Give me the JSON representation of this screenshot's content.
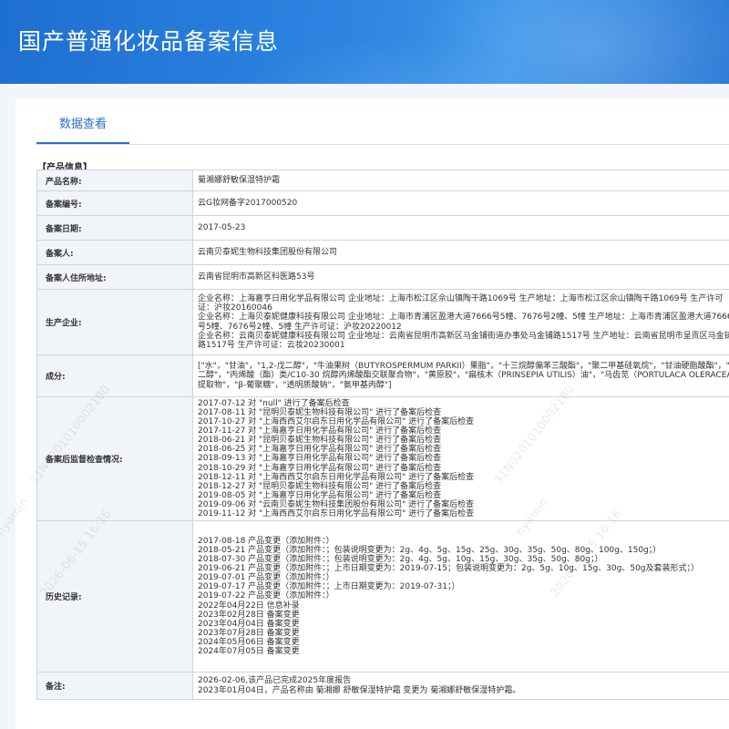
{
  "header": {
    "title": "国产普通化妆品备案信息"
  },
  "tabs": [
    {
      "label": "数据查看"
    }
  ],
  "section": {
    "title": "【产品信息】"
  },
  "rows": {
    "product_name": {
      "label": "产品名称:",
      "value": "菊湘娜舒敏保湿特护霜"
    },
    "record_no": {
      "label": "备案编号:",
      "value": "云G妆网备字2017000520"
    },
    "record_date": {
      "label": "备案日期:",
      "value": "2017-05-23"
    },
    "registrant": {
      "label": "备案人:",
      "value": "云南贝泰妮生物科技集团股份有限公司"
    },
    "registrant_address": {
      "label": "备案人住所地址:",
      "value": "云南省昆明市高新区科医路53号"
    },
    "manufacturer": {
      "label": "生产企业:",
      "lines": [
        "企业名称：上海嘉亨日用化学品有限公司 企业地址：上海市松江区佘山镇陶干路1069号 生产地址：上海市松江区佘山镇陶干路1069号 生产许可证：沪妆20160046",
        "企业名称：上海贝泰妮健康科技有限公司 企业地址：上海市青浦区盈港大道7666号5幢、7676号2幢、5幢 生产地址：上海市青浦区盈港大道7666号5幢、7676号2幢、5幢 生产许可证：沪妆20220012",
        "企业名称：云南贝泰妮健康科技有限公司 企业地址：云南省昆明市高新区马金铺街道办事处马金铺路1517号 生产地址：云南省昆明市呈贡区马金铺路1517号 生产许可证：云妆20230001"
      ]
    },
    "ingredients": {
      "label": "成分:",
      "value": "[\"水\"，\"甘油\"，\"1,2-戊二醇\"，\"牛油果树（BUTYROSPERMUM PARKII）果脂\"，\"十三烷醇偏苯三酸酯\"，\"聚二甲基硅氧烷\"，\"甘油硬脂酸酯\"，\"丁二醇\"，\"丙烯酸（酯）类/C10-30 烷醇丙烯酸酯交联聚合物\"，\"黄原胶\"，\"扁核木（PRINSEPIA UTILIS）油\"，\"马齿苋（PORTULACA OLERACEA）提取物\"，\"β-葡聚糖\"，\"透明质酸钠\"，\"氨甲基丙醇\"]"
    },
    "inspection": {
      "label": "备案后监督检查情况:",
      "lines": [
        "2017-07-12 对 \"null\" 进行了备案后检查",
        "2017-08-11 对 \"昆明贝泰妮生物科技有限公司\" 进行了备案后检查",
        "2017-10-27 对 \"上海西西艾尔启东日用化学品有限公司\" 进行了备案后检查",
        "2017-11-27 对 \"上海嘉亨日用化学品有限公司\" 进行了备案后检查",
        "2018-06-21 对 \"昆明贝泰妮生物科技有限公司\" 进行了备案后检查",
        "2018-06-25 对 \"上海嘉亨日用化学品有限公司\" 进行了备案后检查",
        "2018-09-13 对 \"上海嘉亨日用化学品有限公司\" 进行了备案后检查",
        "2018-10-29 对 \"上海嘉亨日用化学品有限公司\" 进行了备案后检查",
        "2018-12-11 对 \"上海西西艾尔启东日用化学品有限公司\" 进行了备案后检查",
        "2018-12-27 对 \"昆明贝泰妮生物科技有限公司\" 进行了备案后检查",
        "2019-08-05 对 \"上海嘉亨日用化学品有限公司\" 进行了备案后检查",
        "2019-09-06 对 \"云南贝泰妮生物科技集团股份有限公司\" 进行了备案后检查",
        "2019-11-12 对 \"上海西西艾尔启东日用化学品有限公司\" 进行了备案后检查"
      ]
    },
    "history": {
      "label": "历史记录:",
      "lines": [
        "2017-08-18 产品变更（添加附件：）",
        "2018-05-21 产品变更（添加附件：；包装说明变更为：2g、4g、5g、15g、25g、30g、35g、50g、80g、100g、150g；）",
        "2018-07-30 产品变更（添加附件：；包装说明变更为：2g、4g、5g、10g、15g、30g、35g、50g、80g；）",
        "2019-06-21 产品变更（添加附件：；上市日期变更为：2019-07-15；包装说明变更为：2g、5g、10g、15g、30g、50g及套装形式；）",
        "2019-07-01 产品变更（添加附件：）",
        "2019-07-17 产品变更（添加附件：；上市日期变更为：2019-07-31；）",
        "2019-07-22 产品变更（添加附件：）",
        "2022年04月22日 信息补录",
        "2023年02月28日 备案变更",
        "2023年04月04日 备案变更",
        "2023年07月28日 备案变更",
        "2024年05月06日 备案变更",
        "2024年07月05日 备案变更"
      ]
    },
    "remarks": {
      "label": "备注:",
      "lines": [
        "2026-02-06,该产品已完成2025年度报告",
        "2023年01月04日，产品名称由 菊湘娜 舒敏保湿特护霜 变更为 菊湘娜舒敏保湿特护霜。"
      ]
    }
  },
  "watermark": {
    "name": "nyamin",
    "code": "31N0201010002180",
    "time": "2026-06-15 16:16"
  },
  "colors": {
    "header": "#2a7ad8",
    "accent": "#2a6fc9",
    "label_bg": "#f1f4f8",
    "border": "#cdd5df"
  }
}
